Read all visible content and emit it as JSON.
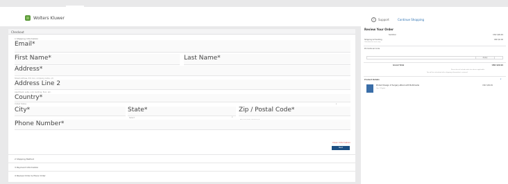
{
  "header": {
    "brand": "Wolters Kluwer",
    "support_label": "Support",
    "continue_label": "Continue Shopping"
  },
  "checkout": {
    "title": "Checkout",
    "step1_label": "1 Shipping Information",
    "fields": {
      "email": "Email*",
      "first_name": "First Name*",
      "last_name": "Last Name*",
      "address": "Address*",
      "address2": "Address Line 2",
      "country": "Country*",
      "city": "City*",
      "state": "State*",
      "zip": "Zip / Postal Code*",
      "phone": "Phone Number*"
    },
    "hints": {
      "address": "Street address, P.O. box, company name, c/o",
      "address2": "Apartment, suite, unit, building, floor, etc.",
      "country": "United States",
      "state": "Select",
      "zip": "Required for shipment"
    },
    "clear_label": "Clear Information",
    "next_label": "Next",
    "steps": [
      "2 Shipping Method",
      "3 Payment Information",
      "4 Review Order & Place Order"
    ]
  },
  "order": {
    "title": "Review Your Order",
    "subtotal_label": "Subtotal",
    "subtotal_value": "USD $99.99",
    "shipping_label": "Shipping & Handling",
    "shipping_value": "USD $0.00",
    "shipping_note": "Calculated at next step",
    "promo_label": "Promotional Code",
    "apply_label": "Apply",
    "total_label": "Grand Total",
    "total_value": "USD $99.99",
    "notice_1": "Prices do not include sales tax where applicable",
    "notice_2": "Tax will be calculated after shipping information is entered",
    "products_label": "Product Details",
    "product_name": "Product Design of Surgery eBook with Multimedia",
    "product_meta": "Qty: 1  Digital",
    "product_price": "USD $99.99"
  },
  "colors": {
    "brand_green": "#5c9a3b",
    "primary_blue": "#1f4f82",
    "link_blue": "#2a6fb0"
  }
}
